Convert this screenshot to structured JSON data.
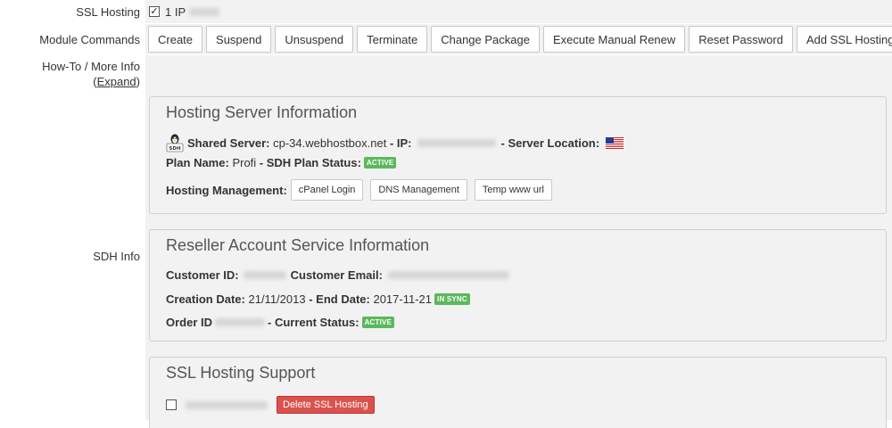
{
  "labels": {
    "ssl_hosting": "SSL Hosting",
    "module_commands": "Module Commands",
    "howto": "How-To / More Info",
    "expand": "Expand",
    "sdh_info": "SDH Info"
  },
  "ssl_row": {
    "checked": true,
    "text": "1 IP"
  },
  "commands": [
    "Create",
    "Suspend",
    "Unsuspend",
    "Terminate",
    "Change Package",
    "Execute Manual Renew",
    "Reset Password",
    "Add SSL Hosting"
  ],
  "hosting_server": {
    "title": "Hosting Server Information",
    "shared_server_label": "Shared Server:",
    "shared_server_value": "cp-34.webhostbox.net",
    "ip_label": "- IP:",
    "server_location_label": "- Server Location:",
    "plan_name_label": "Plan Name:",
    "plan_name_value": "Profi",
    "plan_status_label": "- SDH Plan Status:",
    "plan_status_badge": "ACTIVE",
    "management_label": "Hosting Management:",
    "buttons": [
      "cPanel Login",
      "DNS Management",
      "Temp www url"
    ]
  },
  "reseller": {
    "title": "Reseller Account Service Information",
    "customer_id_label": "Customer ID:",
    "customer_email_label": "Customer Email:",
    "creation_date_label": "Creation Date:",
    "creation_date_value": "21/11/2013",
    "end_date_label": "- End Date:",
    "end_date_value": "2017-11-21",
    "sync_badge": "IN SYNC",
    "order_id_label": "Order ID",
    "current_status_label": "- Current Status:",
    "current_status_badge": "ACTIVE"
  },
  "ssl_support": {
    "title": "SSL Hosting Support",
    "delete_button": "Delete SSL Hosting"
  },
  "colors": {
    "badge_green": "#5cb85c",
    "danger_red": "#d9534f",
    "field_bg": "#f2f2f2"
  },
  "icons": {
    "linux_sdh": "tux-penguin-icon",
    "flag": "us-flag-icon"
  }
}
